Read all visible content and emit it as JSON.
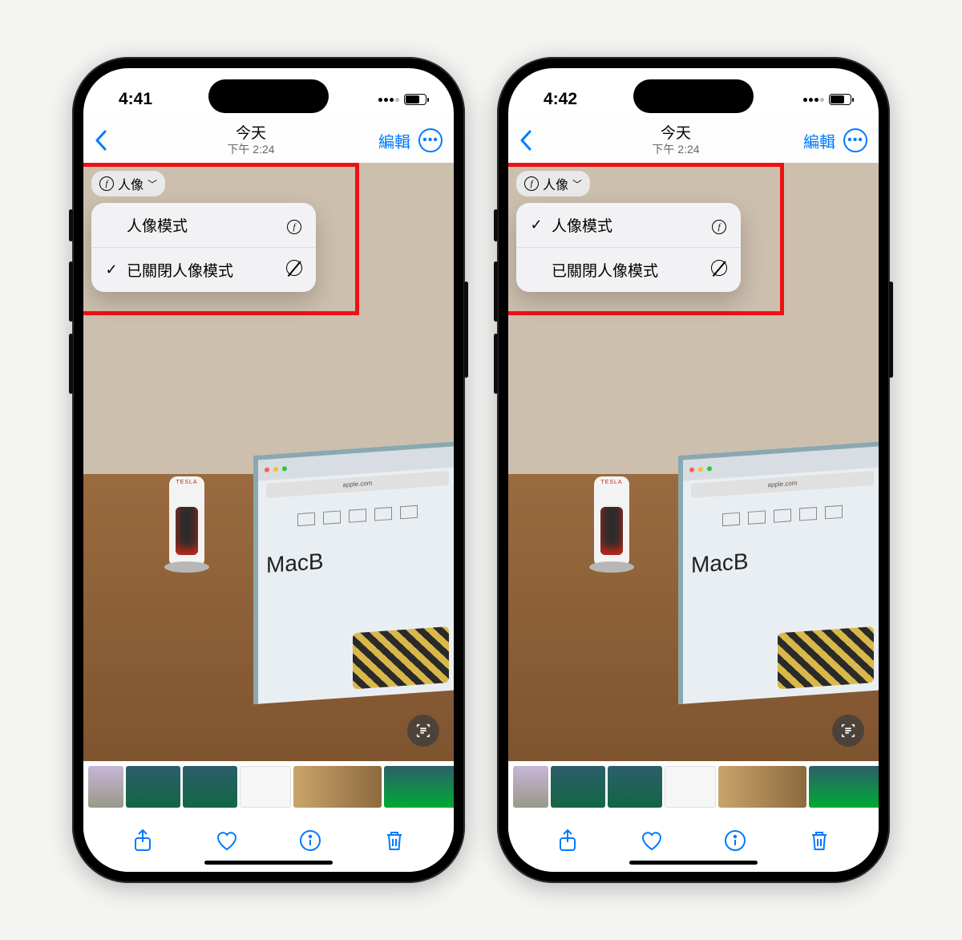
{
  "phones": [
    {
      "status_time": "4:41",
      "nav": {
        "title": "今天",
        "subtitle": "下午 2:24",
        "edit": "編輯"
      },
      "portrait_chip": "人像",
      "menu": {
        "portrait_on": {
          "label": "人像模式",
          "checked": false
        },
        "portrait_off": {
          "label": "已關閉人像模式",
          "checked": true
        }
      },
      "laptop": {
        "url": "apple.com",
        "big": "MacB"
      },
      "charger_label": "TESLA"
    },
    {
      "status_time": "4:42",
      "nav": {
        "title": "今天",
        "subtitle": "下午 2:24",
        "edit": "編輯"
      },
      "portrait_chip": "人像",
      "menu": {
        "portrait_on": {
          "label": "人像模式",
          "checked": true
        },
        "portrait_off": {
          "label": "已關閉人像模式",
          "checked": false
        }
      },
      "laptop": {
        "url": "apple.com",
        "big": "MacB"
      },
      "charger_label": "TESLA"
    }
  ],
  "checkmark_glyph": "✓",
  "chevron_down": "﹀"
}
